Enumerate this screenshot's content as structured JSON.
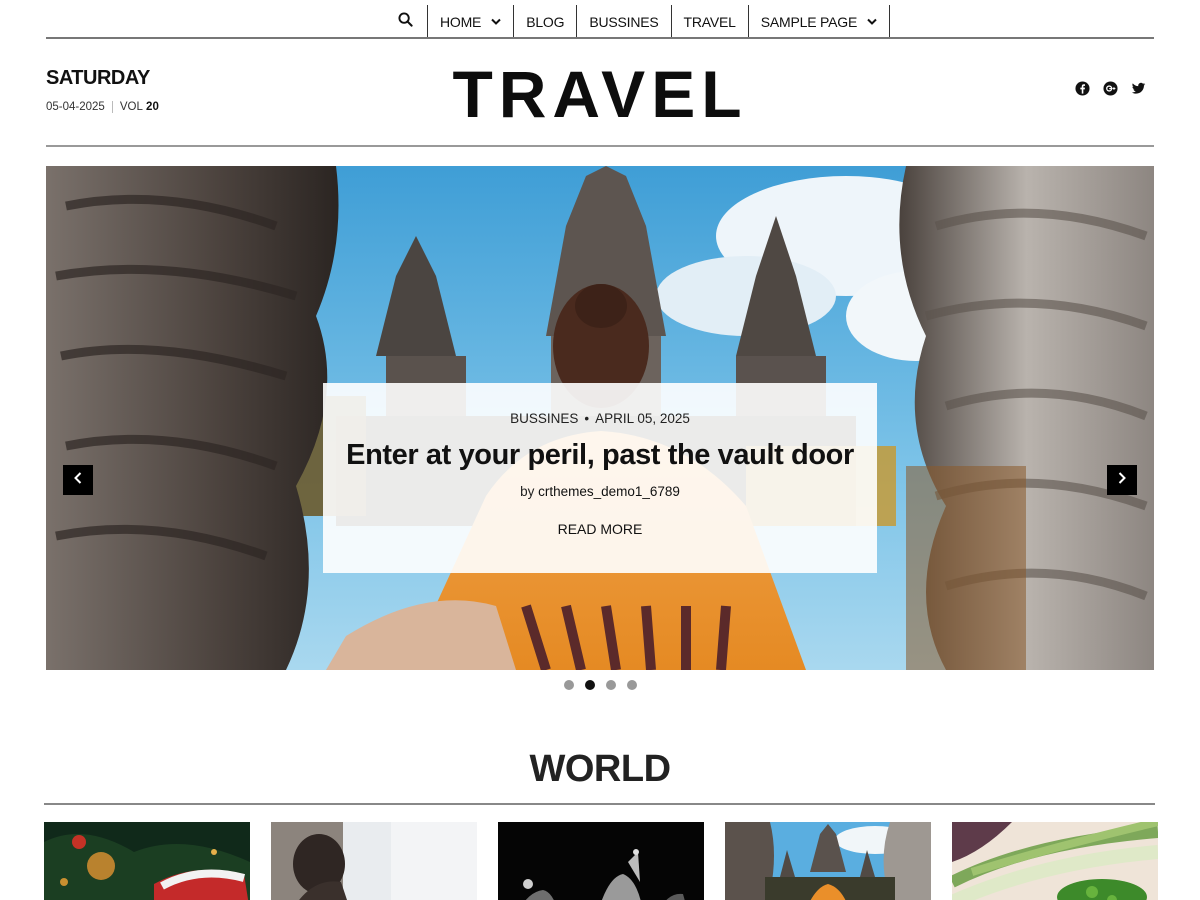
{
  "nav": {
    "items": [
      {
        "label": "Home",
        "has_dropdown": true
      },
      {
        "label": "Blog",
        "has_dropdown": false
      },
      {
        "label": "Bussines",
        "has_dropdown": false
      },
      {
        "label": "Travel",
        "has_dropdown": false
      },
      {
        "label": "Sample Page",
        "has_dropdown": true
      }
    ]
  },
  "header": {
    "day": "SATURDAY",
    "date": "05-04-2025",
    "vol_label": "VOL",
    "vol_number": "20",
    "site_title": "TRAVEL",
    "social_icons": [
      "facebook-icon",
      "google-plus-icon",
      "twitter-icon"
    ]
  },
  "slider": {
    "category": "Bussines",
    "bullet": "•",
    "date": "April 05, 2025",
    "title": "Enter at your peril, past the vault door",
    "by_label": "by",
    "author": "crthemes_demo1_6789",
    "read_more": "Read More",
    "slide_count": 4,
    "active_index": 1
  },
  "world": {
    "title": "WORLD",
    "thumbnails": [
      "christmas-ornaments",
      "woman-window",
      "concert-crowd",
      "temple-gate",
      "green-onions"
    ]
  },
  "colors": {
    "text": "#111111",
    "rule": "#888888",
    "arrow_bg": "#000000",
    "dot_inactive": "#999999",
    "dot_active": "#111111"
  }
}
